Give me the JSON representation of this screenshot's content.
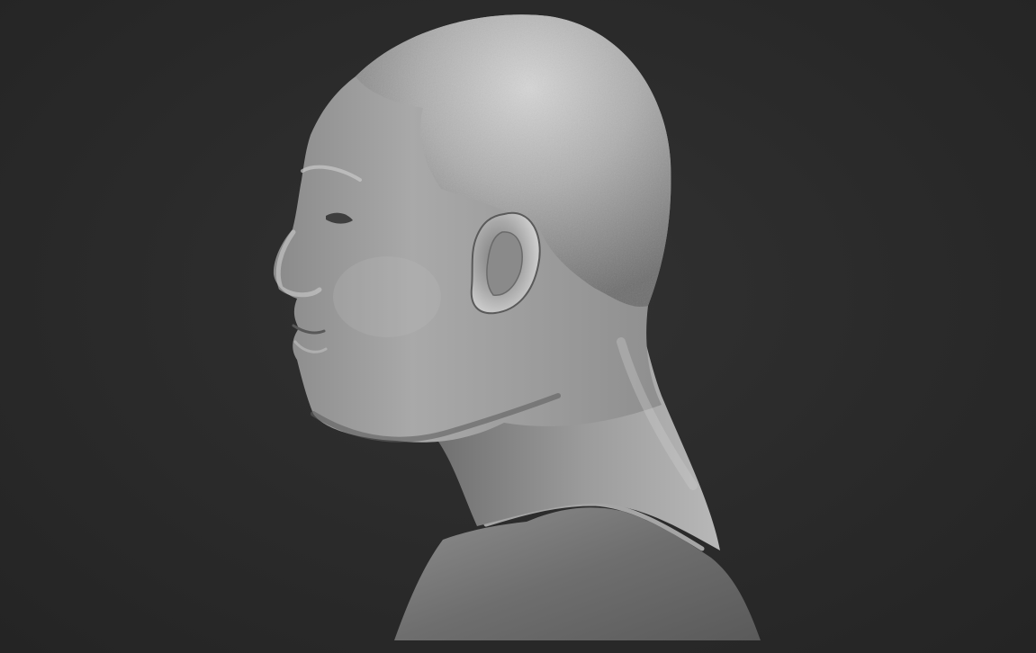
{
  "viewport": {
    "background_color": "#2a2a2a",
    "subject": "bust-sculpt-render",
    "view": "left-profile",
    "material_color": "#9a9a9a"
  }
}
